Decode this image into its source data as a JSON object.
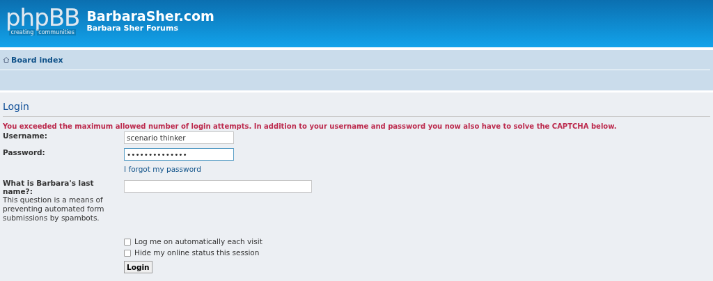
{
  "header": {
    "logo": {
      "main": "phpBB",
      "tagline_left": "creating",
      "tagline_right": "communities"
    },
    "site_title": "BarbaraSher.com",
    "site_description": "Barbara Sher Forums"
  },
  "navbar": {
    "breadcrumb": "Board index"
  },
  "login": {
    "title": "Login",
    "error": "You exceeded the maximum allowed number of login attempts. In addition to your username and password you now also have to solve the CAPTCHA below.",
    "fields": [
      {
        "kind": "text",
        "label": "Username:",
        "value": "scenario thinker",
        "focused": false
      },
      {
        "kind": "password",
        "label": "Password:",
        "value": "••••••••••••••",
        "focused": true,
        "link": "I forgot my password"
      },
      {
        "kind": "question",
        "label": "What is Barbara's last name?:",
        "explain": "This question is a means of preventing automated form submissions by spambots.",
        "focused": false
      }
    ],
    "options": [
      {
        "label": "Log me on automatically each visit",
        "checked": false
      },
      {
        "label": "Hide my online status this session",
        "checked": false
      }
    ],
    "submit": "Login"
  }
}
